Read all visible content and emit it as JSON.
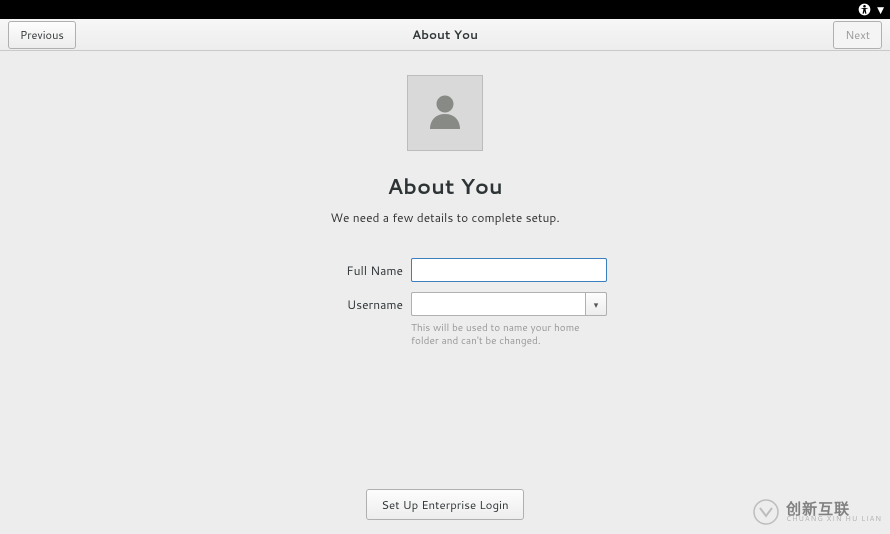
{
  "topbar": {
    "icons": [
      "accessibility-icon",
      "chevron-down-icon"
    ]
  },
  "header": {
    "previous_label": "Previous",
    "title": "About You",
    "next_label": "Next"
  },
  "page": {
    "heading": "About You",
    "subtext": "We need a few details to complete setup."
  },
  "form": {
    "fullname_label": "Full Name",
    "fullname_value": "",
    "username_label": "Username",
    "username_value": "",
    "username_hint": "This will be used to name your home folder and can't be changed."
  },
  "footer": {
    "enterprise_label": "Set Up Enterprise Login"
  },
  "watermark": {
    "main": "创新互联",
    "sub": "CHUANG XIN HU LIAN"
  }
}
